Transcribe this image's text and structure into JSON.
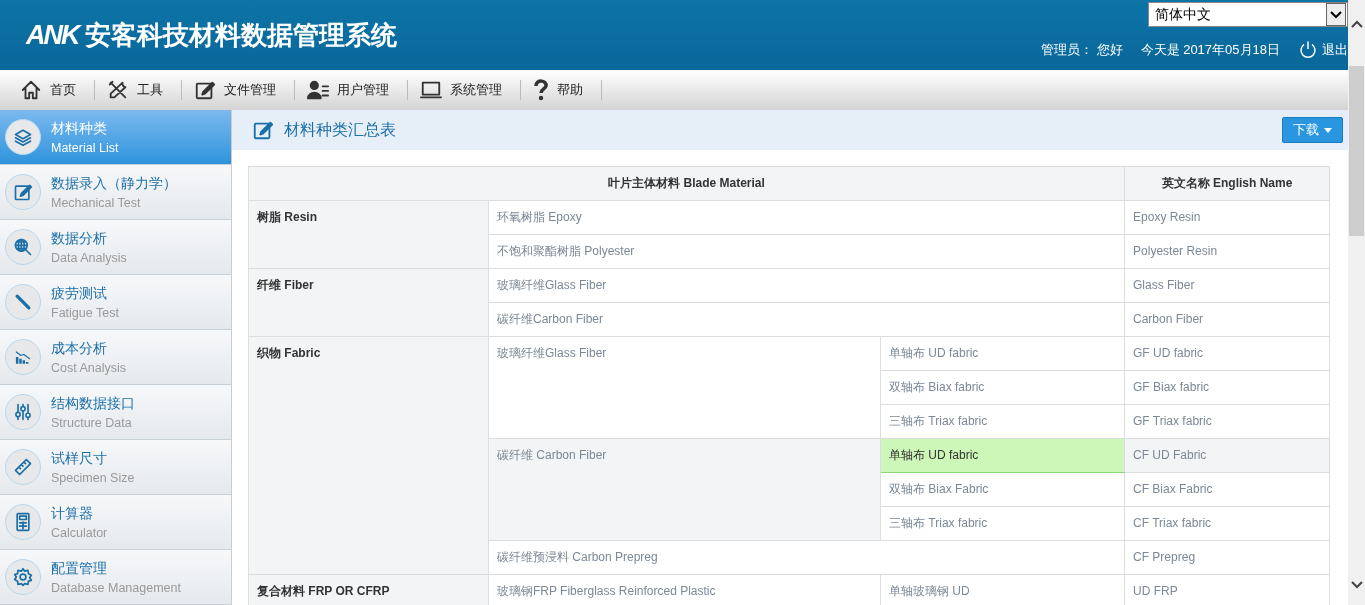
{
  "header": {
    "logo": "ANK",
    "title": "安客科技材料数据管理系统",
    "language": "简体中文",
    "greeting": "管理员： 您好",
    "date": "今天是 2017年05月18日",
    "logout": "退出"
  },
  "nav": [
    {
      "kind": "home",
      "label": "首页"
    },
    {
      "kind": "tools",
      "label": "工具"
    },
    {
      "kind": "edit",
      "label": "文件管理"
    },
    {
      "kind": "user",
      "label": "用户管理"
    },
    {
      "kind": "monitor",
      "label": "系统管理"
    },
    {
      "kind": "help",
      "label": "帮助"
    }
  ],
  "sidebar": {
    "items": [
      {
        "kind": "layers",
        "title": "材料种类",
        "subtitle": "Material List",
        "selected": true
      },
      {
        "kind": "edit",
        "title": "数据录入（静力学）",
        "subtitle": "Mechanical Test",
        "selected": false
      },
      {
        "kind": "globe",
        "title": "数据分析",
        "subtitle": "Data Analysis",
        "selected": false
      },
      {
        "kind": "rod",
        "title": "疲劳测试",
        "subtitle": "Fatigue Test",
        "selected": false
      },
      {
        "kind": "bars",
        "title": "成本分析",
        "subtitle": "Cost Analysis",
        "selected": false
      },
      {
        "kind": "sliders",
        "title": "结构数据接口",
        "subtitle": "Structure Data",
        "selected": false
      },
      {
        "kind": "ruler",
        "title": "试样尺寸",
        "subtitle": "Specimen Size",
        "selected": false
      },
      {
        "kind": "calc",
        "title": "计算器",
        "subtitle": "Calculator",
        "selected": false
      },
      {
        "kind": "gear",
        "title": "配置管理",
        "subtitle": "Database Management",
        "selected": false
      }
    ]
  },
  "panel": {
    "title": "材料种类汇总表",
    "download": "下载"
  },
  "table": {
    "columns": [
      "叶片主体材料 Blade Material",
      "英文名称 English Name"
    ],
    "groups": [
      {
        "category": "树脂 Resin",
        "materials": [
          {
            "name": "环氧树脂 Epoxy",
            "english": "Epoxy Resin"
          },
          {
            "name": "不饱和聚酯树脂 Polyester",
            "english": "Polyester Resin"
          }
        ]
      },
      {
        "category": "纤维 Fiber",
        "materials": [
          {
            "name": "玻璃纤维Glass Fiber",
            "english": "Glass Fiber"
          },
          {
            "name": "碳纤维Carbon Fiber",
            "english": "Carbon Fiber"
          }
        ]
      },
      {
        "category": "织物 Fabric",
        "materials": [
          {
            "name": "玻璃纤维Glass Fiber",
            "variants": [
              {
                "name": "单轴布 UD fabric",
                "english": "GF UD fabric",
                "selected": false
              },
              {
                "name": "双轴布 Biax fabric",
                "english": "GF Biax fabric",
                "selected": false
              },
              {
                "name": "三轴布 Triax fabric",
                "english": "GF Triax fabric",
                "selected": false
              }
            ]
          },
          {
            "name": "碳纤维 Carbon Fiber",
            "variants": [
              {
                "name": "单轴布 UD fabric",
                "english": "CF UD Fabric",
                "selected": true
              },
              {
                "name": "双轴布 Biax Fabric",
                "english": "CF Biax Fabric",
                "selected": false
              },
              {
                "name": "三轴布 Triax fabric",
                "english": "CF Triax fabric",
                "selected": false
              }
            ]
          },
          {
            "name": "碳纤维预浸料 Carbon Prepreg",
            "english": "CF Prepreg"
          }
        ]
      },
      {
        "category": "复合材料 FRP OR CFRP",
        "materials": [
          {
            "name": "玻璃钢FRP Fiberglass Reinforced Plastic",
            "variants": [
              {
                "name": "单轴玻璃钢 UD",
                "english": "UD FRP",
                "selected": false
              }
            ]
          }
        ]
      }
    ]
  }
}
